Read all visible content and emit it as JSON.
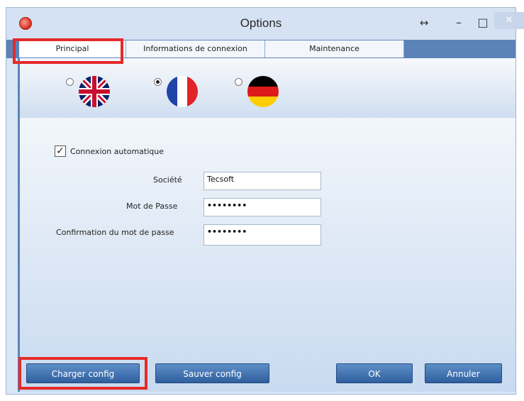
{
  "window": {
    "title": "Options",
    "resize_glyph": "↔",
    "minimize_glyph": "–",
    "maximize_glyph": "□",
    "close_glyph": "✕"
  },
  "tabs": [
    {
      "label": "Principal",
      "active": true
    },
    {
      "label": "Informations de connexion",
      "active": false
    },
    {
      "label": "Maintenance",
      "active": false
    }
  ],
  "languages": [
    {
      "name": "english",
      "flag_icon": "uk-flag-icon",
      "selected": false
    },
    {
      "name": "french",
      "flag_icon": "france-flag-icon",
      "selected": true
    },
    {
      "name": "german",
      "flag_icon": "germany-flag-icon",
      "selected": false
    }
  ],
  "form": {
    "auto_login_label": "Connexion automatique",
    "auto_login_checked": true,
    "company_label": "Société",
    "company_value": "Tecsoft",
    "password_label": "Mot de Passe",
    "password_value": "••••••••",
    "confirm_label": "Confirmation du mot de passe",
    "confirm_value": "••••••••"
  },
  "buttons": {
    "load_config": "Charger config",
    "save_config": "Sauver config",
    "ok": "OK",
    "cancel": "Annuler"
  },
  "colors": {
    "highlight": "#e52a2a",
    "accent": "#5b83b8"
  }
}
